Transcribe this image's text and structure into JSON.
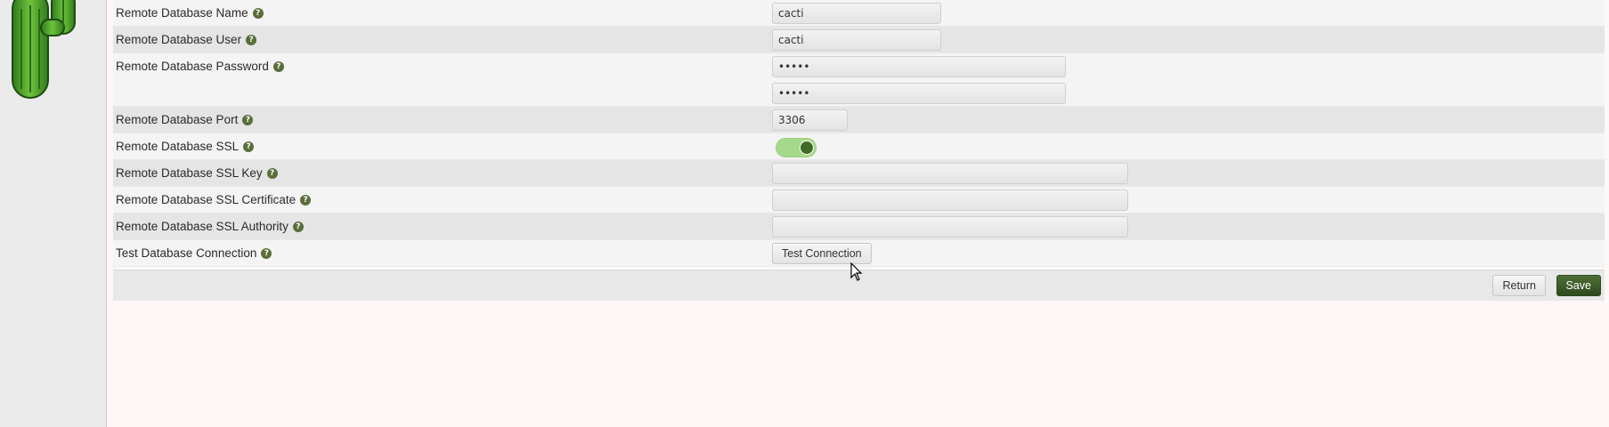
{
  "icons": {
    "logo": "cactus-logo-icon",
    "help": "question-circle-icon",
    "toggle_knob": "toggle-knob-icon",
    "cursor": "mouse-pointer-icon"
  },
  "help_glyph": "?",
  "colors": {
    "accent": "#4e6e36",
    "toggle_on": "#a7d98c",
    "row_dark": "#e5e5e5",
    "row_light": "#f4f4f4"
  },
  "form": {
    "db_name": {
      "label": "Remote Database Name",
      "value": "cacti"
    },
    "db_user": {
      "label": "Remote Database User",
      "value": "cacti"
    },
    "db_password": {
      "label": "Remote Database Password",
      "value": "•••••",
      "confirm_value": "•••••"
    },
    "db_port": {
      "label": "Remote Database Port",
      "value": "3306"
    },
    "db_ssl": {
      "label": "Remote Database SSL",
      "enabled": true
    },
    "ssl_key": {
      "label": "Remote Database SSL Key",
      "value": ""
    },
    "ssl_cert": {
      "label": "Remote Database SSL Certificate",
      "value": ""
    },
    "ssl_ca": {
      "label": "Remote Database SSL Authority",
      "value": ""
    },
    "test_conn": {
      "label": "Test Database Connection",
      "button": "Test Connection"
    }
  },
  "footer": {
    "return_label": "Return",
    "save_label": "Save"
  }
}
